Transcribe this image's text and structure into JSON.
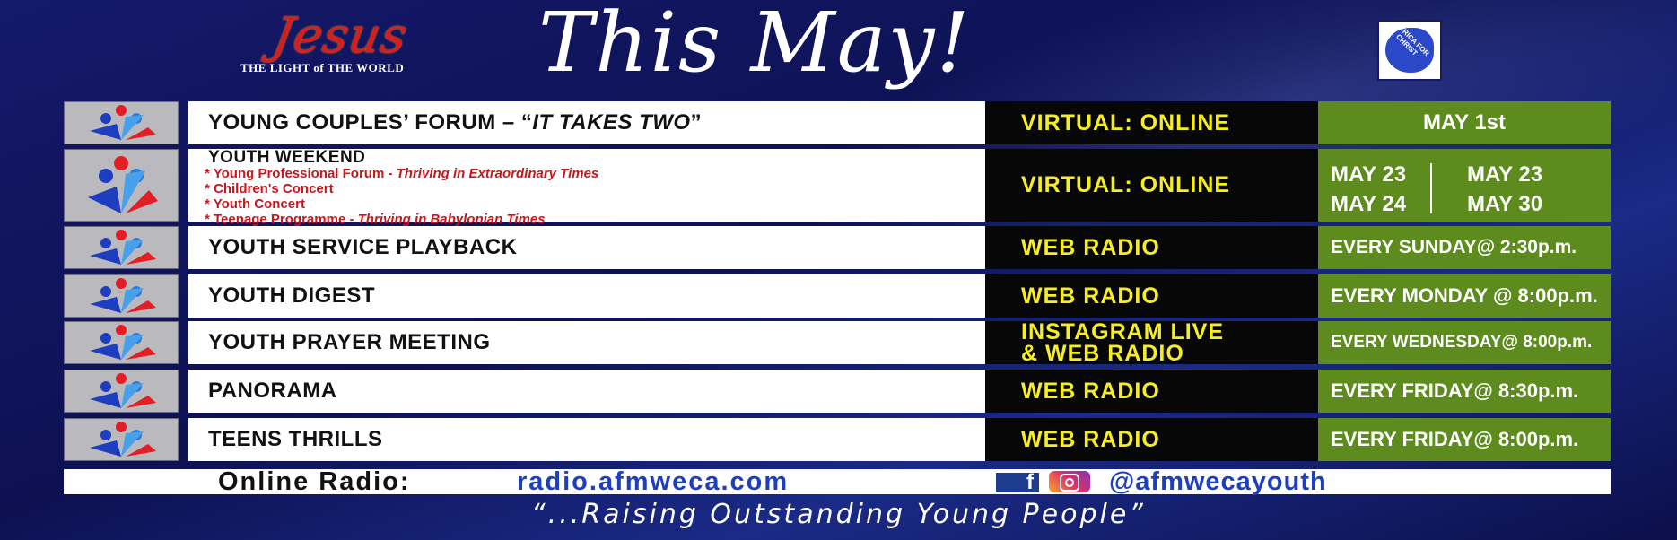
{
  "header": {
    "logo": {
      "word": "Jesus",
      "tagline": "THE LIGHT of THE WORLD"
    },
    "title": "This May!",
    "badge": {
      "text": "AFRICA FOR CHRIST"
    }
  },
  "rows": [
    {
      "title_plain": "YOUNG COUPLES’ FORUM – “",
      "title_italic": "IT TAKES TWO",
      "title_end": "”",
      "where": "VIRTUAL: ONLINE",
      "when": "MAY 1st"
    },
    {
      "title": "YOUTH WEEKEND",
      "items": [
        {
          "plain": "* Young Professional Forum - ",
          "italic": "Thriving in Extraordinary Times"
        },
        {
          "plain": "* Children's Concert",
          "italic": ""
        },
        {
          "plain": "* Youth Concert",
          "italic": ""
        },
        {
          "plain": "* Teenage Programme - ",
          "italic": "Thriving in Babylonian Times"
        }
      ],
      "where": "VIRTUAL: ONLINE",
      "dates_left": [
        "MAY 23",
        "MAY 24"
      ],
      "dates_right": [
        "MAY 23",
        "MAY 30"
      ]
    },
    {
      "title": "YOUTH SERVICE PLAYBACK",
      "where": "WEB RADIO",
      "when": "EVERY SUNDAY@ 2:30p.m."
    },
    {
      "title": "YOUTH DIGEST",
      "where": "WEB RADIO",
      "when": "EVERY MONDAY @ 8:00p.m."
    },
    {
      "title": "YOUTH PRAYER MEETING",
      "where_line1": "INSTAGRAM LIVE",
      "where_line2": "& WEB RADIO",
      "when": "EVERY WEDNESDAY@ 8:00p.m."
    },
    {
      "title": "PANORAMA",
      "where": "WEB RADIO",
      "when": "EVERY FRIDAY@ 8:30p.m."
    },
    {
      "title": "TEENS THRILLS",
      "where": "WEB RADIO",
      "when": "EVERY FRIDAY@ 8:00p.m."
    }
  ],
  "footer": {
    "radio_label": "Online Radio:",
    "radio_url": "radio.afmweca.com",
    "social_handle": "@afmwecayouth",
    "tagline": "“...Raising Outstanding Young People”"
  },
  "colors": {
    "background": "#15196a",
    "green": "#5d8b1e",
    "yellow": "#f6ed22",
    "red": "#c8161d",
    "link_blue": "#1d3fbf"
  },
  "icons": [
    "youth-figures-logo-icon",
    "facebook-icon",
    "instagram-icon"
  ]
}
